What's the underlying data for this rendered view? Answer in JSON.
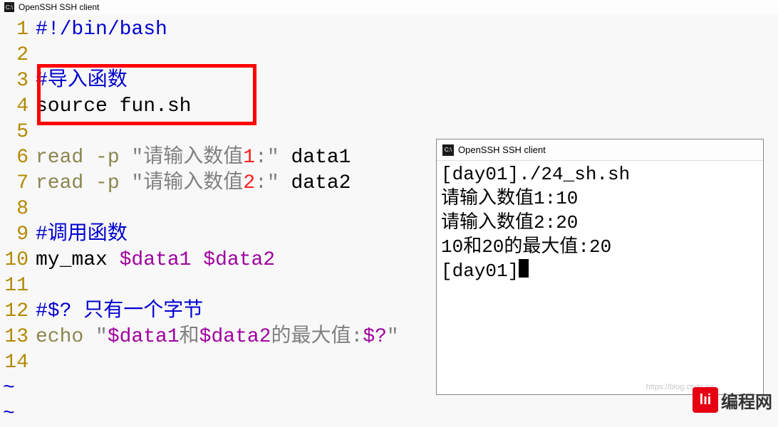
{
  "main_title": "OpenSSH SSH client",
  "terminal_title": "OpenSSH SSH client",
  "code": {
    "l1_shebang": "#!/bin/bash",
    "l3_comment": "#导入函数",
    "l4_source": "source fun.sh",
    "l6_read": "read -p ",
    "l6_str_a": "\"请输入数值",
    "l6_str_b": ":\"",
    "l6_num": "1",
    "l6_var": " data1",
    "l7_read": "read -p ",
    "l7_str_a": "\"请输入数值",
    "l7_str_b": ":\"",
    "l7_num": "2",
    "l7_var": " data2",
    "l9_comment": "#调用函数",
    "l10_fn": "my_max ",
    "l10_v1": "$data1",
    "l10_sp": " ",
    "l10_v2": "$data2",
    "l12_comment": "#$? 只有一个字节",
    "l13_echo": "echo ",
    "l13_q1": "\"",
    "l13_v1": "$data1",
    "l13_txt1": "和",
    "l13_v2": "$data2",
    "l13_txt2": "的最大值:",
    "l13_v3": "$?",
    "l13_q2": "\""
  },
  "gutter": [
    "1",
    "2",
    "3",
    "4",
    "5",
    "6",
    "7",
    "8",
    "9",
    "10",
    "11",
    "12",
    "13",
    "14"
  ],
  "terminal": {
    "l1": "[day01]./24_sh.sh",
    "l2": "请输入数值1:10",
    "l3": "请输入数值2:20",
    "l4": "10和20的最大值:20",
    "l5": "[day01]"
  },
  "logo_text": "编程网",
  "logo_icon": "lıi",
  "watermark": "https://blog.csdn.ne"
}
